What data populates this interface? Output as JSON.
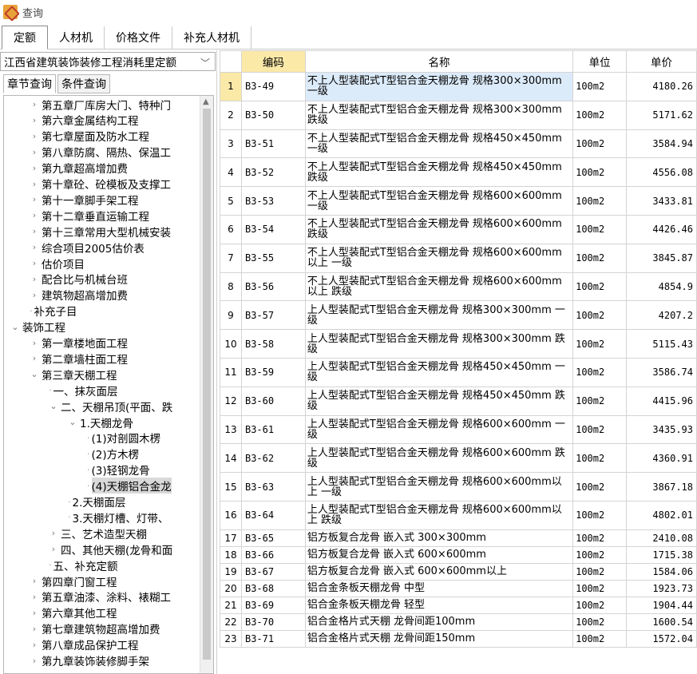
{
  "window": {
    "title": "查询"
  },
  "top_tabs": [
    "定额",
    "人材机",
    "价格文件",
    "补充人材机"
  ],
  "left": {
    "dropdown_value": "江西省建筑装饰装修工程消耗里定额",
    "sub_tabs": [
      "章节查询",
      "条件查询"
    ],
    "tree": [
      {
        "label": "第五章厂库房大门、特种门",
        "level": 2,
        "icon": "›"
      },
      {
        "label": "第六章金属结构工程",
        "level": 2,
        "icon": "›"
      },
      {
        "label": "第七章屋面及防水工程",
        "level": 2,
        "icon": "›"
      },
      {
        "label": "第八章防腐、隔热、保温工",
        "level": 2,
        "icon": "›"
      },
      {
        "label": "第九章超高增加费",
        "level": 2,
        "icon": "›"
      },
      {
        "label": "第十章砼、砼模板及支撑工",
        "level": 2,
        "icon": "›"
      },
      {
        "label": "第十一章脚手架工程",
        "level": 2,
        "icon": "›"
      },
      {
        "label": "第十二章垂直运输工程",
        "level": 2,
        "icon": "›"
      },
      {
        "label": "第十三章常用大型机械安装",
        "level": 2,
        "icon": "›"
      },
      {
        "label": "综合项目2005估价表",
        "level": 2,
        "icon": "›"
      },
      {
        "label": "估价项目",
        "level": 2,
        "icon": "›"
      },
      {
        "label": "配合比与机械台班",
        "level": 2,
        "icon": "›"
      },
      {
        "label": "建筑物超高增加费",
        "level": 2,
        "icon": "›"
      },
      {
        "label": "补充子目",
        "level": 2,
        "icon": "·"
      },
      {
        "label": "装饰工程",
        "level": 1,
        "icon": "⌄"
      },
      {
        "label": "第一章楼地面工程",
        "level": 2,
        "icon": "›"
      },
      {
        "label": "第二章墙柱面工程",
        "level": 2,
        "icon": "›"
      },
      {
        "label": "第三章天棚工程",
        "level": 2,
        "icon": "⌄"
      },
      {
        "label": "一、抹灰面层",
        "level": 3,
        "icon": "·"
      },
      {
        "label": "二、天棚吊顶(平面、跌",
        "level": 3,
        "icon": "⌄"
      },
      {
        "label": "1.天棚龙骨",
        "level": 4,
        "icon": "⌄"
      },
      {
        "label": "(1)对剖圆木楞",
        "level": 5,
        "icon": "·"
      },
      {
        "label": "(2)方木楞",
        "level": 5,
        "icon": "·"
      },
      {
        "label": "(3)轻钢龙骨",
        "level": 5,
        "icon": "·"
      },
      {
        "label": "(4)天棚铝合金龙",
        "level": 5,
        "icon": "·",
        "selected": true
      },
      {
        "label": "2.天棚面层",
        "level": 4,
        "icon": "·"
      },
      {
        "label": "3.天棚灯槽、灯带、",
        "level": 4,
        "icon": "·"
      },
      {
        "label": "三、艺术造型天棚",
        "level": 3,
        "icon": "›"
      },
      {
        "label": "四、其他天棚(龙骨和面",
        "level": 3,
        "icon": "›"
      },
      {
        "label": "五、补充定额",
        "level": 3,
        "icon": "·"
      },
      {
        "label": "第四章门窗工程",
        "level": 2,
        "icon": "›"
      },
      {
        "label": "第五章油漆、涂料、裱糊工",
        "level": 2,
        "icon": "›"
      },
      {
        "label": "第六章其他工程",
        "level": 2,
        "icon": "›"
      },
      {
        "label": "第七章建筑物超高增加费",
        "level": 2,
        "icon": "›"
      },
      {
        "label": "第八章成品保护工程",
        "level": 2,
        "icon": "›"
      },
      {
        "label": "第九章装饰装修脚手架",
        "level": 2,
        "icon": "›"
      }
    ]
  },
  "table": {
    "headers": {
      "idx": "",
      "code": "编码",
      "name": "名称",
      "unit": "单位",
      "price": "单价"
    },
    "rows": [
      {
        "idx": "1",
        "code": "B3-49",
        "name": "不上人型装配式T型铝合金天棚龙骨 规格300×300mm 一级",
        "unit": "100m2",
        "price": "4180.26",
        "selected": true
      },
      {
        "idx": "2",
        "code": "B3-50",
        "name": "不上人型装配式T型铝合金天棚龙骨 规格300×300mm 跌级",
        "unit": "100m2",
        "price": "5171.62"
      },
      {
        "idx": "3",
        "code": "B3-51",
        "name": "不上人型装配式T型铝合金天棚龙骨 规格450×450mm 一级",
        "unit": "100m2",
        "price": "3584.94"
      },
      {
        "idx": "4",
        "code": "B3-52",
        "name": "不上人型装配式T型铝合金天棚龙骨 规格450×450mm 跌级",
        "unit": "100m2",
        "price": "4556.08"
      },
      {
        "idx": "5",
        "code": "B3-53",
        "name": "不上人型装配式T型铝合金天棚龙骨 规格600×600mm 一级",
        "unit": "100m2",
        "price": "3433.81"
      },
      {
        "idx": "6",
        "code": "B3-54",
        "name": "不上人型装配式T型铝合金天棚龙骨 规格600×600mm 跌级",
        "unit": "100m2",
        "price": "4426.46"
      },
      {
        "idx": "7",
        "code": "B3-55",
        "name": "不上人型装配式T型铝合金天棚龙骨 规格600×600mm以上 一级",
        "unit": "100m2",
        "price": "3845.87"
      },
      {
        "idx": "8",
        "code": "B3-56",
        "name": "不上人型装配式T型铝合金天棚龙骨 规格600×600mm以上 跌级",
        "unit": "100m2",
        "price": "4854.9"
      },
      {
        "idx": "9",
        "code": "B3-57",
        "name": "上人型装配式T型铝合金天棚龙骨 规格300×300mm 一级",
        "unit": "100m2",
        "price": "4207.2"
      },
      {
        "idx": "10",
        "code": "B3-58",
        "name": "上人型装配式T型铝合金天棚龙骨 规格300×300mm 跌级",
        "unit": "100m2",
        "price": "5115.43"
      },
      {
        "idx": "11",
        "code": "B3-59",
        "name": "上人型装配式T型铝合金天棚龙骨 规格450×450mm 一级",
        "unit": "100m2",
        "price": "3586.74"
      },
      {
        "idx": "12",
        "code": "B3-60",
        "name": "上人型装配式T型铝合金天棚龙骨 规格450×450mm 跌级",
        "unit": "100m2",
        "price": "4415.96"
      },
      {
        "idx": "13",
        "code": "B3-61",
        "name": "上人型装配式T型铝合金天棚龙骨 规格600×600mm 一级",
        "unit": "100m2",
        "price": "3435.93"
      },
      {
        "idx": "14",
        "code": "B3-62",
        "name": "上人型装配式T型铝合金天棚龙骨 规格600×600mm 跌级",
        "unit": "100m2",
        "price": "4360.91"
      },
      {
        "idx": "15",
        "code": "B3-63",
        "name": "上人型装配式T型铝合金天棚龙骨 规格600×600mm以上 一级",
        "unit": "100m2",
        "price": "3867.18"
      },
      {
        "idx": "16",
        "code": "B3-64",
        "name": "上人型装配式T型铝合金天棚龙骨 规格600×600mm以上 跌级",
        "unit": "100m2",
        "price": "4802.01"
      },
      {
        "idx": "17",
        "code": "B3-65",
        "name": "铝方板复合龙骨 嵌入式 300×300mm",
        "unit": "100m2",
        "price": "2410.08",
        "short": true
      },
      {
        "idx": "18",
        "code": "B3-66",
        "name": "铝方板复合龙骨 嵌入式 600×600mm",
        "unit": "100m2",
        "price": "1715.38",
        "short": true
      },
      {
        "idx": "19",
        "code": "B3-67",
        "name": "铝方板复合龙骨 嵌入式 600×600mm以上",
        "unit": "100m2",
        "price": "1584.06",
        "short": true
      },
      {
        "idx": "20",
        "code": "B3-68",
        "name": "铝合金条板天棚龙骨 中型",
        "unit": "100m2",
        "price": "1923.73",
        "short": true
      },
      {
        "idx": "21",
        "code": "B3-69",
        "name": "铝合金条板天棚龙骨 轻型",
        "unit": "100m2",
        "price": "1904.44",
        "short": true
      },
      {
        "idx": "22",
        "code": "B3-70",
        "name": "铝合金格片式天棚 龙骨间距100mm",
        "unit": "100m2",
        "price": "1600.54",
        "short": true
      },
      {
        "idx": "23",
        "code": "B3-71",
        "name": "铝合金格片式天棚 龙骨间距150mm",
        "unit": "100m2",
        "price": "1572.04",
        "short": true
      }
    ]
  }
}
